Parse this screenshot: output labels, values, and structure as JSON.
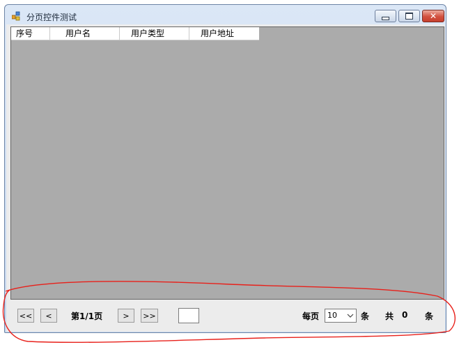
{
  "window": {
    "title": "分页控件测试"
  },
  "grid": {
    "columns": [
      "序号",
      "用户名",
      "用户类型",
      "用户地址"
    ],
    "rows": []
  },
  "pager": {
    "first_label": "<<",
    "prev_label": "<",
    "page_info": "第1/1页",
    "next_label": ">",
    "last_label": ">>",
    "jump_value": "",
    "per_page_label": "每页",
    "page_size_selected": "10",
    "page_size_unit": "条",
    "total_label": "共",
    "total_count": "0",
    "total_unit": "条"
  },
  "colors": {
    "grid_background": "#ababab",
    "annotation_stroke": "#e8201a",
    "close_button": "#c7402e"
  },
  "icons": {
    "app": "app-icon",
    "minimize": "minimize-icon",
    "maximize": "maximize-icon",
    "close": "close-icon",
    "dropdown": "chevron-down-icon"
  }
}
